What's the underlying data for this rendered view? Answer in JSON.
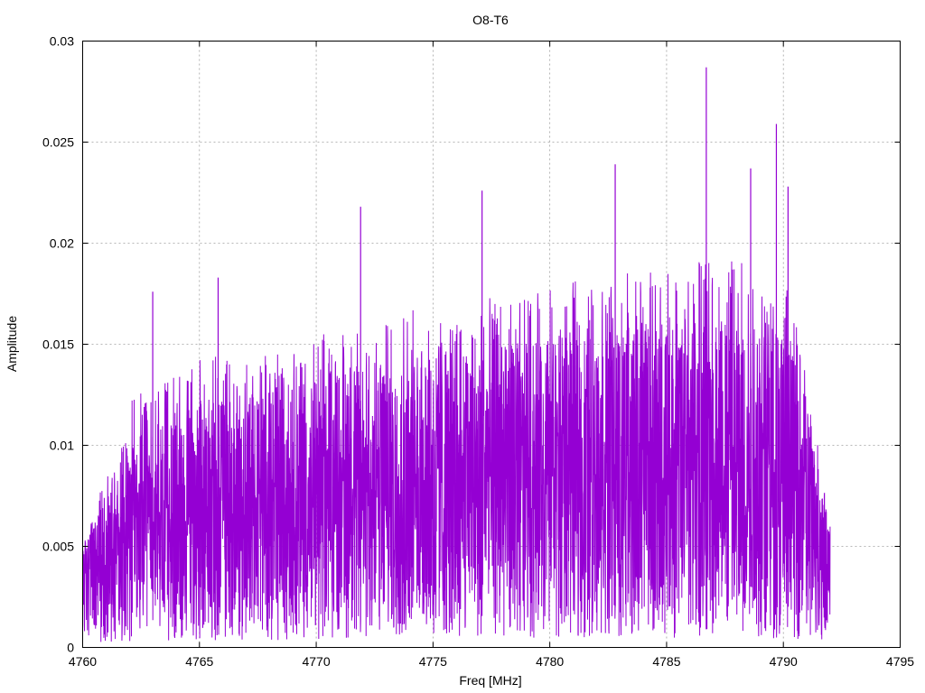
{
  "chart_data": {
    "type": "line",
    "title": "O8-T6",
    "xlabel": "Freq [MHz]",
    "ylabel": "Amplitude",
    "xlim": [
      4760,
      4795
    ],
    "ylim": [
      0,
      0.03
    ],
    "x_ticks": [
      "4760",
      "4765",
      "4770",
      "4775",
      "4780",
      "4785",
      "4790",
      "4795"
    ],
    "y_ticks": [
      "0",
      "0.005",
      "0.01",
      "0.015",
      "0.02",
      "0.025",
      "0.03"
    ],
    "grid": true,
    "legend": "none",
    "series": [
      {
        "color": "#9400d3",
        "x_range": [
          4760,
          4792
        ],
        "description": "dense noise-like spectrum",
        "envelope": {
          "x": [
            4760,
            4762,
            4765,
            4768,
            4770,
            4772,
            4775,
            4778,
            4780,
            4783,
            4785,
            4787,
            4789,
            4790,
            4791,
            4791.5,
            4792
          ],
          "median": [
            0.0045,
            0.006,
            0.0068,
            0.0072,
            0.0078,
            0.0082,
            0.0085,
            0.0088,
            0.009,
            0.0093,
            0.0095,
            0.0095,
            0.0093,
            0.0088,
            0.0075,
            0.006,
            0.0045
          ],
          "typical_max": [
            0.005,
            0.012,
            0.014,
            0.0145,
            0.015,
            0.016,
            0.0165,
            0.017,
            0.0175,
            0.018,
            0.0185,
            0.019,
            0.019,
            0.018,
            0.014,
            0.01,
            0.006
          ]
        },
        "peaks": [
          {
            "x": 4763.0,
            "y": 0.0176
          },
          {
            "x": 4765.8,
            "y": 0.0183
          },
          {
            "x": 4771.9,
            "y": 0.0218
          },
          {
            "x": 4777.1,
            "y": 0.0226
          },
          {
            "x": 4782.8,
            "y": 0.0239
          },
          {
            "x": 4786.7,
            "y": 0.0287
          },
          {
            "x": 4788.6,
            "y": 0.0237
          },
          {
            "x": 4789.7,
            "y": 0.0259
          },
          {
            "x": 4790.2,
            "y": 0.0228
          },
          {
            "x": 4791.8,
            "y": 0.0067
          }
        ]
      }
    ]
  }
}
